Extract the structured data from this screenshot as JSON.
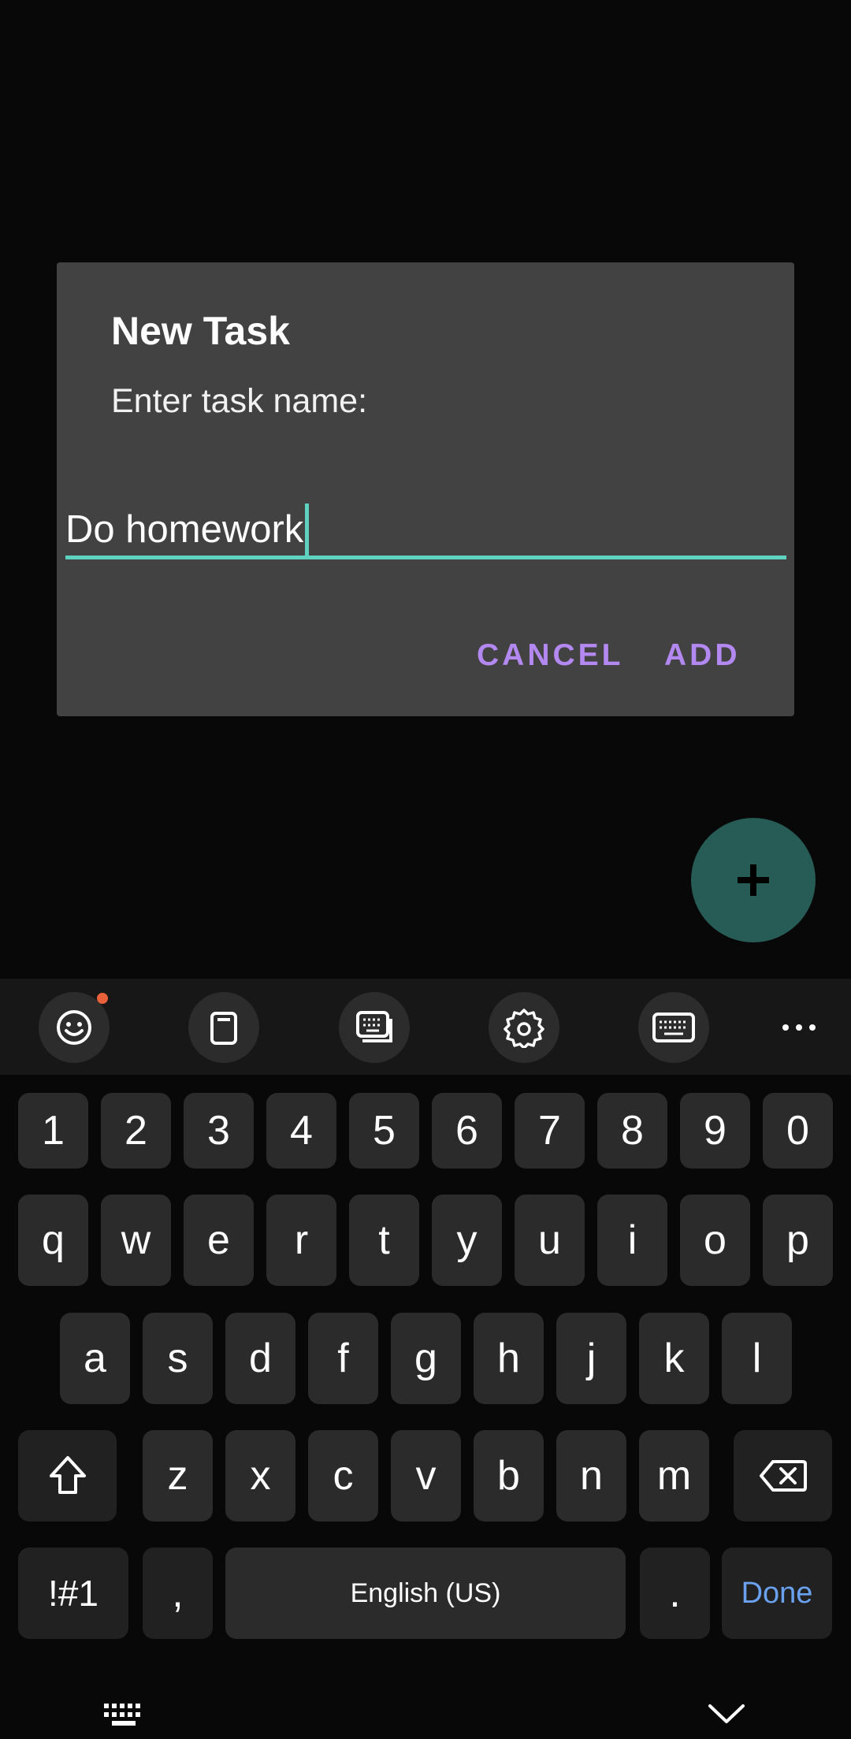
{
  "dialog": {
    "title": "New Task",
    "message": "Enter task name:",
    "input_value": "Do homework",
    "cancel_label": "CANCEL",
    "add_label": "ADD"
  },
  "fab": {
    "icon": "plus-icon"
  },
  "keyboard": {
    "toolbar": [
      "emoji-icon",
      "clipboard-icon",
      "keyboard-settings-icon",
      "gear-icon",
      "keyboard-mode-icon",
      "more-icon"
    ],
    "row_numbers": [
      "1",
      "2",
      "3",
      "4",
      "5",
      "6",
      "7",
      "8",
      "9",
      "0"
    ],
    "row1": [
      "q",
      "w",
      "e",
      "r",
      "t",
      "y",
      "u",
      "i",
      "o",
      "p"
    ],
    "row2": [
      "a",
      "s",
      "d",
      "f",
      "g",
      "h",
      "j",
      "k",
      "l"
    ],
    "row3": [
      "z",
      "x",
      "c",
      "v",
      "b",
      "n",
      "m"
    ],
    "sym_label": "!#1",
    "comma_label": ",",
    "space_label": "English (US)",
    "period_label": ".",
    "done_label": "Done"
  },
  "colors": {
    "accent_teal": "#5ed1c0",
    "button_purple": "#b388f0",
    "done_blue": "#6aa2f0",
    "fab_green": "#275b55"
  }
}
